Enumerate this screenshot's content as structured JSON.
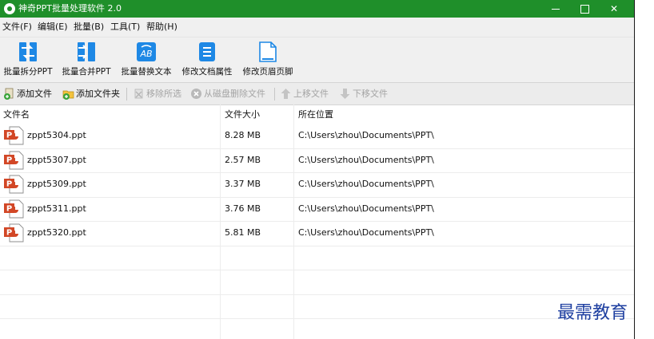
{
  "window": {
    "title": "神奇PPT批量处理软件 2.0"
  },
  "menu": [
    {
      "label": "文件(F)"
    },
    {
      "label": "编辑(E)"
    },
    {
      "label": "批量(B)"
    },
    {
      "label": "工具(T)"
    },
    {
      "label": "帮助(H)"
    }
  ],
  "ribbon": [
    {
      "label": "批量拆分PPT",
      "icon": "split-ppt-icon"
    },
    {
      "label": "批量合并PPT",
      "icon": "merge-ppt-icon"
    },
    {
      "label": "批量替换文本",
      "icon": "replace-text-icon"
    },
    {
      "label": "修改文档属性",
      "icon": "document-properties-icon"
    },
    {
      "label": "修改页眉页脚",
      "icon": "header-footer-icon"
    }
  ],
  "toolbar": {
    "add_file": "添加文件",
    "add_folder": "添加文件夹",
    "remove_selected": "移除所选",
    "delete_from_disk": "从磁盘删除文件",
    "move_up": "上移文件",
    "move_down": "下移文件"
  },
  "table": {
    "columns": [
      "文件名",
      "文件大小",
      "所在位置"
    ],
    "rows": [
      {
        "name": "zppt5304.ppt",
        "size": "8.28 MB",
        "location": "C:\\Users\\zhou\\Documents\\PPT\\"
      },
      {
        "name": "zppt5307.ppt",
        "size": "2.57 MB",
        "location": "C:\\Users\\zhou\\Documents\\PPT\\"
      },
      {
        "name": "zppt5309.ppt",
        "size": "3.37 MB",
        "location": "C:\\Users\\zhou\\Documents\\PPT\\"
      },
      {
        "name": "zppt5311.ppt",
        "size": "3.76 MB",
        "location": "C:\\Users\\zhou\\Documents\\PPT\\"
      },
      {
        "name": "zppt5320.ppt",
        "size": "5.81 MB",
        "location": "C:\\Users\\zhou\\Documents\\PPT\\"
      }
    ]
  },
  "watermark": "最需教育",
  "colors": {
    "titlebar": "#1f8f2a",
    "ribbon_icon": "#1e88e5",
    "ppt_icon": "#d24726"
  }
}
